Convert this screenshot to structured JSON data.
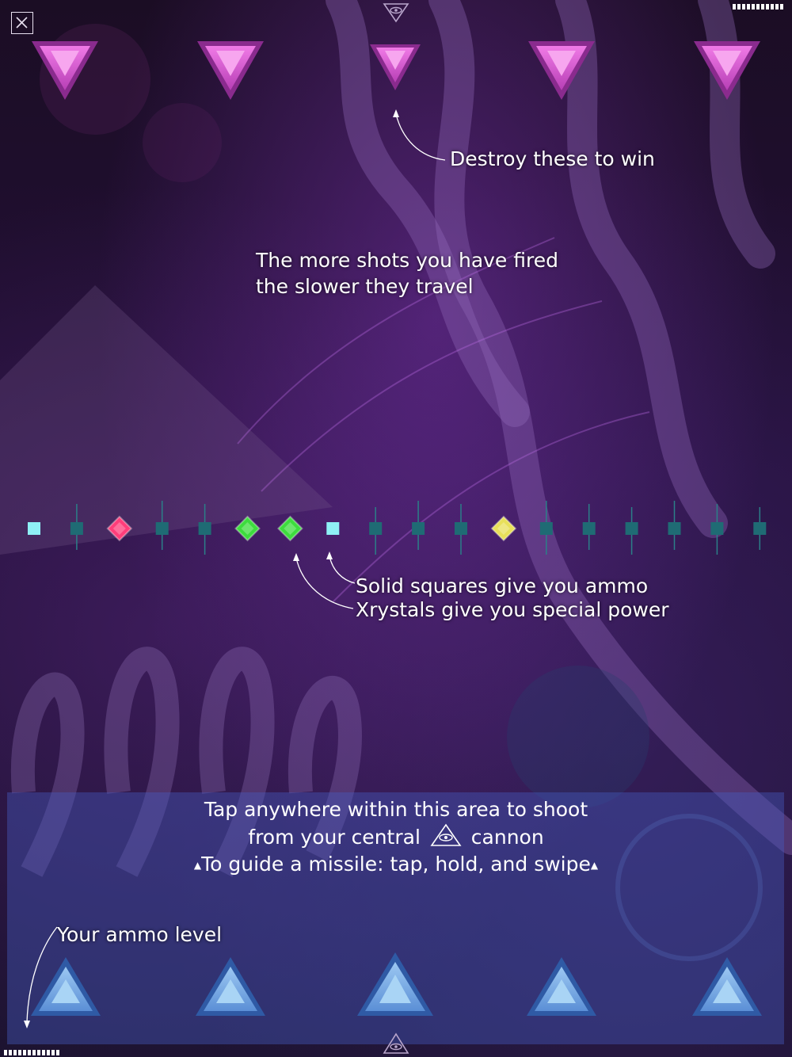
{
  "game": {
    "close_icon": "close-icon",
    "instructions": {
      "targets": "Destroy these to win",
      "shots_line1": "The more shots you have fired",
      "shots_line2": "the slower they travel",
      "squares": "Solid squares give you ammo",
      "crystals": "Xrystals give you special power",
      "tap_line1": "Tap anywhere within this area to shoot",
      "tap_line2_pre": "from your central",
      "tap_line2_post": "cannon",
      "tap_line3": "To guide a missile: tap, hold, and swipe",
      "ammo": "Your ammo level"
    },
    "enemy_targets": [
      "target-1",
      "target-2",
      "target-3",
      "target-4",
      "target-5"
    ],
    "player_cannons": [
      "cannon-1",
      "cannon-2",
      "cannon-3",
      "cannon-4",
      "cannon-5"
    ],
    "pickups": [
      {
        "type": "square",
        "style": "solid"
      },
      {
        "type": "square",
        "style": "dim"
      },
      {
        "type": "crystal",
        "color": "#ff3d7a"
      },
      {
        "type": "square",
        "style": "dim"
      },
      {
        "type": "square",
        "style": "dim"
      },
      {
        "type": "crystal",
        "color": "#3ddc3d"
      },
      {
        "type": "crystal",
        "color": "#3ddc3d"
      },
      {
        "type": "square",
        "style": "solid"
      },
      {
        "type": "square",
        "style": "dim"
      },
      {
        "type": "square",
        "style": "dim"
      },
      {
        "type": "square",
        "style": "dim"
      },
      {
        "type": "crystal",
        "color": "#e8e05a"
      },
      {
        "type": "square",
        "style": "dim"
      },
      {
        "type": "square",
        "style": "dim"
      },
      {
        "type": "square",
        "style": "dim"
      },
      {
        "type": "square",
        "style": "dim"
      },
      {
        "type": "square",
        "style": "dim"
      },
      {
        "type": "square",
        "style": "dim"
      }
    ],
    "colors": {
      "enemy": "#d45ccf",
      "cannon": "#5b8fd6",
      "solid_square": "#8ff0f5",
      "dim_square": "#1f6b74",
      "tap_zone": "#4a5abe"
    }
  }
}
